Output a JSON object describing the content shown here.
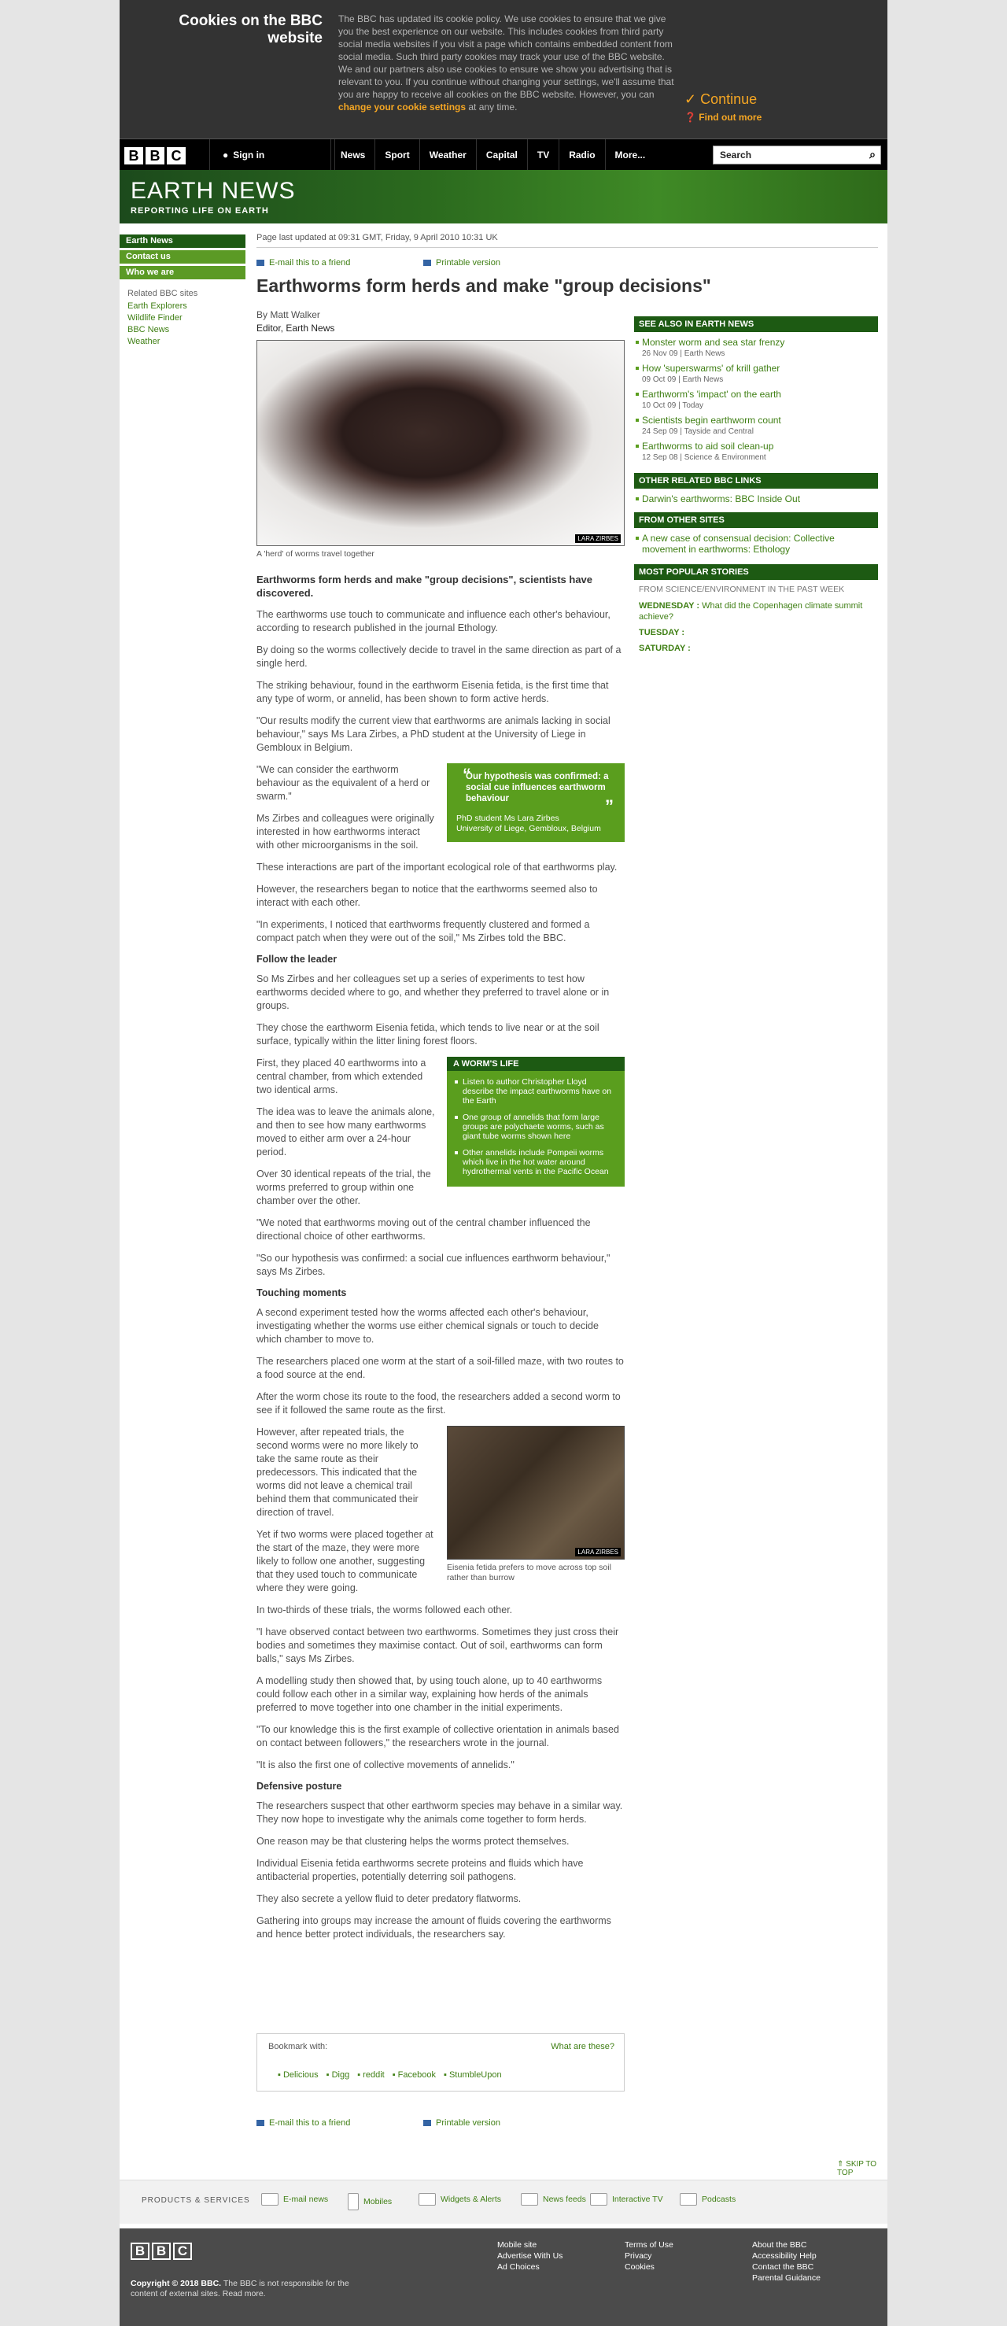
{
  "cookie": {
    "title": "Cookies on the BBC website",
    "text": "The BBC has updated its cookie policy. We use cookies to ensure that we give you the best experience on our website. This includes cookies from third party social media websites if you visit a page which contains embedded content from social media. Such third party cookies may track your use of the BBC website. We and our partners also use cookies to ensure we show you advertising that is relevant to you. If you continue without changing your settings, we'll assume that you are happy to receive all cookies on the BBC website. However, you can",
    "link": "change your cookie settings",
    "tail": " at any time.",
    "continue": "Continue",
    "find_out": "Find out more"
  },
  "nav": {
    "logo": [
      "B",
      "B",
      "C"
    ],
    "sign_in": "Sign in",
    "items": [
      "News",
      "Sport",
      "Weather",
      "Capital",
      "TV",
      "Radio",
      "More..."
    ],
    "search_placeholder": "Search"
  },
  "banner": {
    "title": "EARTH NEWS",
    "subtitle": "REPORTING LIFE ON EARTH"
  },
  "leftnav": {
    "items": [
      "Earth News",
      "Contact us",
      "Who we are"
    ],
    "related_label": "Related BBC sites",
    "related": [
      "Earth Explorers",
      "Wildlife Finder",
      "BBC News",
      "Weather"
    ]
  },
  "article": {
    "updated": "Page last updated at 09:31 GMT, Friday, 9 April 2010 10:31 UK",
    "email": "E-mail this to a friend",
    "print": "Printable version",
    "headline": "Earthworms form herds and make \"group decisions\"",
    "by": "By Matt Walker",
    "role": "Editor, Earth News",
    "photo_credit": "LARA ZIRBES",
    "caption": "A 'herd' of worms travel together",
    "p": [
      "Earthworms form herds and make \"group decisions\", scientists have discovered.",
      "The earthworms use touch to communicate and influence each other's behaviour, according to research published in the journal Ethology.",
      "By doing so the worms collectively decide to travel in the same direction as part of a single herd.",
      "The striking behaviour, found in the earthworm Eisenia fetida, is the first time that any type of worm, or annelid, has been shown to form active herds.",
      "\"Our results modify the current view that earthworms are animals lacking in social behaviour,\" says Ms Lara Zirbes, a PhD student at the University of Liege in Gembloux in Belgium.",
      "\"We can consider the earthworm behaviour as the equivalent of a herd or swarm.\"",
      "Ms Zirbes and colleagues were originally interested in how earthworms interact with other microorganisms in the soil.",
      "These interactions are part of the important ecological role of that earthworms play.",
      "However, the researchers began to notice that the earthworms seemed also to interact with each other.",
      "\"In experiments, I noticed that earthworms frequently clustered and formed a compact patch when they were out of the soil,\" Ms Zirbes told the BBC.",
      "So Ms Zirbes and her colleagues set up a series of experiments to test how earthworms decided where to go, and whether they preferred to travel alone or in groups.",
      "They chose the earthworm Eisenia fetida, which tends to live near or at the soil surface, typically within the litter lining forest floors.",
      "First, they placed 40 earthworms into a central chamber, from which extended two identical arms.",
      "The idea was to leave the animals alone, and then to see how many earthworms moved to either arm over a 24-hour period.",
      "Over 30 identical repeats of the trial, the worms preferred to group within one chamber over the other.",
      "\"We noted that earthworms moving out of the central chamber influenced the directional choice of other earthworms.",
      "\"So our hypothesis was confirmed: a social cue influences earthworm behaviour,\" says Ms Zirbes.",
      "A second experiment tested how the worms affected each other's behaviour, investigating whether the worms use either chemical signals or touch to decide which chamber to move to.",
      "The researchers placed one worm at the start of a soil-filled maze, with two routes to a food source at the end.",
      "After the worm chose its route to the food, the researchers added a second worm to see if it followed the same route as the first.",
      "However, after repeated trials, the second worms were no more likely to take the same route as their predecessors. This indicated that the worms did not leave a chemical trail behind them that communicated their direction of travel.",
      "Yet if two worms were placed together at the start of the maze, they were more likely to follow one another, suggesting that they used touch to communicate where they were going.",
      "In two-thirds of these trials, the worms followed each other.",
      "\"I have observed contact between two earthworms. Sometimes they just cross their bodies and sometimes they maximise contact. Out of soil, earthworms can form balls,\" says Ms Zirbes.",
      "A modelling study then showed that, by using touch alone, up to 40 earthworms could follow each other in a similar way, explaining how herds of the animals preferred to move together into one chamber in the initial experiments.",
      "\"To our knowledge this is the first example of collective orientation in animals based on contact between followers,\" the researchers wrote in the journal.",
      "\"It is also the first one of collective movements of annelids.\"",
      "The researchers suspect that other earthworm species may behave in a similar way. They now hope to investigate why the animals come together to form herds.",
      "One reason may be that clustering helps the worms protect themselves.",
      "Individual Eisenia fetida earthworms secrete proteins and fluids which have antibacterial properties, potentially deterring soil pathogens.",
      "They also secrete a yellow fluid to deter predatory flatworms.",
      "Gathering into groups may increase the amount of fluids covering the earthworms and hence better protect individuals, the researchers say."
    ],
    "h": [
      "Follow the leader",
      "Touching moments",
      "Defensive posture"
    ],
    "pull_quote": "Our hypothesis was confirmed: a social cue influences earthworm behaviour",
    "pull_who": "PhD student Ms Lara Zirbes",
    "pull_org": "University of Liege, Gembloux, Belgium",
    "box_title": "A WORM'S LIFE",
    "box_items": [
      "Listen to author Christopher Lloyd describe the impact earthworms have on the Earth",
      "One group of annelids that form large groups are polychaete worms, such as giant tube worms shown here",
      "Other annelids include Pompeii worms which live in the hot water around hydrothermal vents in the Pacific Ocean"
    ],
    "img2_caption": "Eisenia fetida prefers to move across top soil rather than burrow",
    "bookmark": "Bookmark with:",
    "what": "What are these?",
    "bookmarks": [
      "Delicious",
      "Digg",
      "reddit",
      "Facebook",
      "StumbleUpon"
    ]
  },
  "side": {
    "see_also": "SEE ALSO IN EARTH NEWS",
    "links": [
      {
        "t": "Monster worm and sea star frenzy",
        "m": "26 Nov 09 |  Earth News"
      },
      {
        "t": "How 'superswarms' of krill gather",
        "m": "09 Oct 09 |  Earth News"
      },
      {
        "t": "Earthworm's 'impact' on the earth",
        "m": "10 Oct 09 |  Today"
      },
      {
        "t": "Scientists begin earthworm count",
        "m": "24 Sep 09 |  Tayside and Central"
      },
      {
        "t": "Earthworms to aid soil clean-up",
        "m": "12 Sep 08 |  Science & Environment"
      }
    ],
    "other": "OTHER RELATED BBC LINKS",
    "other_links": [
      "Darwin's earthworms: BBC Inside Out"
    ],
    "from": "FROM OTHER SITES",
    "from_links": [
      "A new case of consensual decision: Collective movement in earthworms: Ethology"
    ],
    "popular": "MOST POPULAR STORIES",
    "pop_sub": "FROM SCIENCE/ENVIRONMENT IN THE PAST WEEK",
    "pop": [
      {
        "d": "WEDNESDAY :",
        "t": "What did the Copenhagen climate summit achieve?"
      },
      {
        "d": "TUESDAY :",
        "t": ""
      },
      {
        "d": "SATURDAY :",
        "t": ""
      }
    ]
  },
  "footer": {
    "skip": "SKIP TO TOP",
    "ps_label": "PRODUCTS & SERVICES",
    "ps": [
      "E-mail news",
      "Mobiles",
      "Widgets & Alerts",
      "News feeds",
      "Interactive TV",
      "Podcasts"
    ],
    "copy_b": "Copyright © 2018 BBC.",
    "copy": " The BBC is not responsible for the content of external sites. Read more.",
    "c1": [
      "Mobile site",
      "Advertise With Us",
      "Ad Choices"
    ],
    "c2": [
      "Terms of Use",
      "Privacy",
      "Cookies"
    ],
    "c3": [
      "About the BBC",
      "Accessibility Help",
      "Contact the BBC",
      "Parental Guidance"
    ]
  }
}
